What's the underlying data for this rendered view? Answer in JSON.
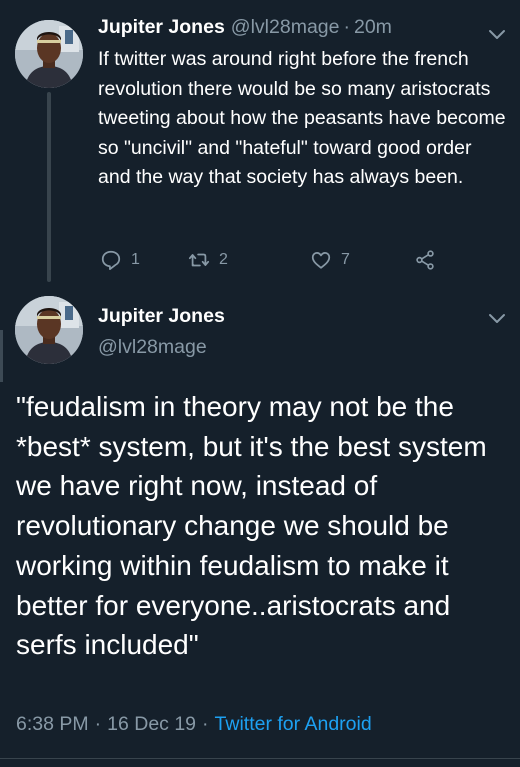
{
  "tweet1": {
    "name": "Jupiter Jones",
    "handle": "@lvl28mage",
    "dot": "·",
    "time": "20m",
    "text": "If twitter was around right before the french revolution there would be so many aristocrats tweeting about how the peasants have become so \"uncivil\" and \"hateful\" toward good order and the way that society has always been.",
    "replies": "1",
    "retweets": "2",
    "likes": "7"
  },
  "tweet2": {
    "name": "Jupiter Jones",
    "handle": "@lvl28mage",
    "text": "\"feudalism in theory may not be the *best* system, but it's the best system we have right now, instead of revolutionary change we should be working within feudalism to make it better for everyone..aristocrats and serfs included\"",
    "time": "6:38 PM",
    "sep1": "·",
    "date": "16 Dec 19",
    "sep2": "·",
    "source": "Twitter for Android"
  },
  "icons": [
    "avatar",
    "chevron-down-icon",
    "reply-icon",
    "retweet-icon",
    "like-icon",
    "share-icon"
  ],
  "colors": {
    "background": "#15202b",
    "text": "#ffffff",
    "secondary": "#8899a6",
    "link": "#1da1f2",
    "thread_line": "#38444d"
  }
}
